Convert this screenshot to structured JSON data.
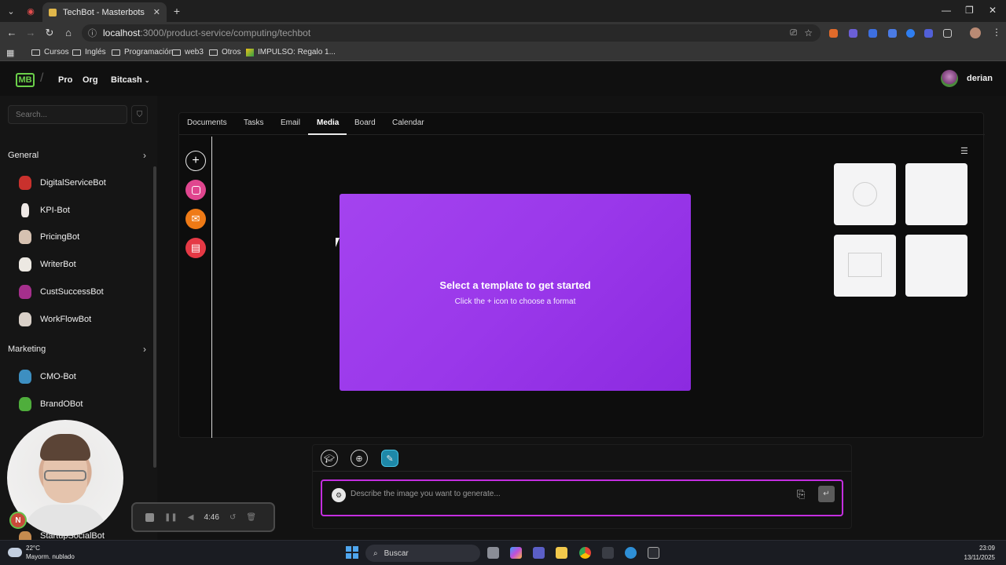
{
  "browser": {
    "tab_title": "TechBot - Masterbots",
    "new_tab": "+",
    "url_host": "localhost",
    "url_path": ":3000/product-service/computing/techbot",
    "bookmarks": [
      "Cursos",
      "Inglés",
      "Programación",
      "web3",
      "Otros",
      "IMPULSO: Regalo 1..."
    ]
  },
  "app": {
    "logo": "MB",
    "nav": [
      "Pro",
      "Org",
      "Bitcash"
    ],
    "user_name": "derian",
    "search_placeholder": "Search..."
  },
  "sidebar": {
    "sections": [
      {
        "title": "General",
        "bots": [
          "DigitalServiceBot",
          "KPI-Bot",
          "PricingBot",
          "WriterBot",
          "CustSuccessBot",
          "WorkFlowBot"
        ]
      },
      {
        "title": "Marketing",
        "bots": [
          "CMO-Bot",
          "BrandOBot",
          "StartupSocialBot"
        ]
      }
    ]
  },
  "recorder": {
    "time": "4:46"
  },
  "webcam": {
    "badge": "N"
  },
  "workspace": {
    "tabs": [
      "Documents",
      "Tasks",
      "Email",
      "Media",
      "Board",
      "Calendar"
    ],
    "active_tab": "Media",
    "preview_title": "Select a template to get started",
    "preview_subtitle": "Click the + icon to choose a format"
  },
  "composer": {
    "placeholder": "Describe the image you want to generate...",
    "value": ""
  },
  "taskbar": {
    "weather_temp": "22°C",
    "weather_desc": "Mayorm. nublado",
    "search_label": "Buscar",
    "time": "23:09",
    "date": "13/11/2025"
  },
  "colors": {
    "accent_purple": "#9a38ea",
    "prompt_border": "#c42ee0",
    "logo_green": "#6bd04a",
    "instagram": "#e0468f",
    "mail": "#ef7a16",
    "doc": "#e53945"
  },
  "icons": [
    "plus-icon",
    "instagram-icon",
    "mail-icon",
    "document-icon",
    "list-view-icon",
    "graduation-cap-icon",
    "globe-icon",
    "image-generate-icon",
    "attach-icon",
    "send-icon",
    "filter-icon",
    "chevron-right-icon"
  ]
}
